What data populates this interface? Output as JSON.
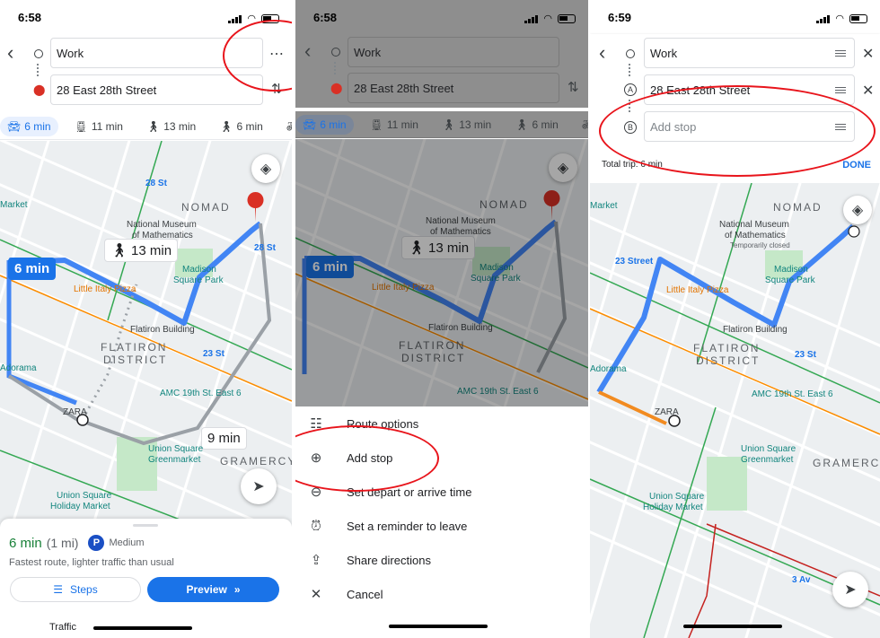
{
  "panel1": {
    "status_time": "6:58",
    "from": "Work",
    "to": "28 East 28th Street",
    "modes": [
      {
        "icon": "car-icon",
        "label": "6 min"
      },
      {
        "icon": "transit-icon",
        "label": "11 min"
      },
      {
        "icon": "walk-icon",
        "label": "13 min"
      },
      {
        "icon": "rideshare-icon",
        "label": "6 min"
      },
      {
        "icon": "bike-icon",
        "label": "6 m"
      }
    ],
    "map": {
      "route_chip": "6 min",
      "walk_chip": "13 min",
      "alt_chip": "9 min",
      "labels": [
        "NOMAD",
        "National Museum",
        "of Mathematics",
        "Madison",
        "Square Park",
        "Little Italy Pizza",
        "Flatiron Building",
        "FLATIRON",
        "DISTRICT",
        "AMC 19th St. East 6",
        "ZARA",
        "Union Square",
        "Greenmarket",
        "Union Square",
        "Holiday Market",
        "GRAMERCY",
        "28 St",
        "23 St",
        "28 St",
        "Adorama",
        "Market"
      ]
    },
    "sheet": {
      "time": "6 min",
      "distance": "(1 mi)",
      "parking_badge": "P",
      "parking": "Medium",
      "desc": "Fastest route, lighter traffic than usual",
      "steps": "Steps",
      "preview": "Preview",
      "traffic": "Traffic"
    }
  },
  "panel2": {
    "status_time": "6:58",
    "from": "Work",
    "to": "28 East 28th Street",
    "modes": [
      {
        "icon": "car-icon",
        "label": "6 min"
      },
      {
        "icon": "transit-icon",
        "label": "11 min"
      },
      {
        "icon": "walk-icon",
        "label": "13 min"
      },
      {
        "icon": "rideshare-icon",
        "label": "6 min"
      },
      {
        "icon": "bike-icon",
        "label": "6"
      }
    ],
    "menu": [
      {
        "icon": "tune-icon",
        "label": "Route options"
      },
      {
        "icon": "add-circle-icon",
        "label": "Add stop"
      },
      {
        "icon": "clock-icon",
        "label": "Set depart or arrive time"
      },
      {
        "icon": "alarm-icon",
        "label": "Set a reminder to leave"
      },
      {
        "icon": "share-icon",
        "label": "Share directions"
      },
      {
        "icon": "close-icon",
        "label": "Cancel"
      }
    ]
  },
  "panel3": {
    "status_time": "6:59",
    "from": "Work",
    "stop_a": "28 East 28th Street",
    "stop_b_placeholder": "Add stop",
    "letter_a": "A",
    "letter_b": "B",
    "total_trip": "Total trip: 6 min",
    "done": "DONE",
    "map_labels": [
      "23 Street",
      "Temporarily closed",
      "3 Av"
    ]
  },
  "colors": {
    "accent": "#1a73e8",
    "route_blue": "#4285f4",
    "annotation_red": "#e8141b",
    "pin_red": "#d93025",
    "park_green": "#c5e8c8"
  }
}
